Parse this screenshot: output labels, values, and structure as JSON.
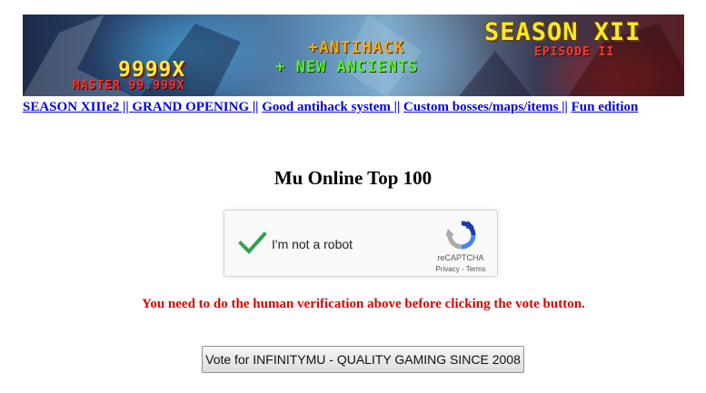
{
  "banner": {
    "season_text": "SEASON XII",
    "episode_text": "EPISODE II",
    "antihack_text": "+ANTIHACK",
    "ancients_text": "+ NEW ANCIENTS",
    "exp_text": "9999X",
    "master_text": "MASTER 99.999X",
    "colors": {
      "season": "#f5ea28",
      "episode": "#ff3a2a",
      "antihack": "#f2a81c",
      "ancients": "#5cf02a",
      "exp": "#f8ee2e",
      "master": "#ff3226"
    }
  },
  "links": [
    {
      "label": "SEASON XIIIe2 || GRAND OPENING ||"
    },
    {
      "label": "Good antihack system ||"
    },
    {
      "label": "Custom bosses/maps/items ||"
    },
    {
      "label": "Fun edition"
    }
  ],
  "page": {
    "title": "Mu Online Top 100"
  },
  "recaptcha": {
    "label": "I'm not a robot",
    "brand": "reCAPTCHA",
    "privacy": "Privacy",
    "separator": " - ",
    "terms": "Terms",
    "checked": true,
    "check_color": "#2fa24b"
  },
  "warning": {
    "text": "You need to do the human verification above before clicking the vote button.",
    "color": "#e00000"
  },
  "vote": {
    "button_label": "Vote for INFINITYMU - QUALITY GAMING SINCE 2008"
  }
}
